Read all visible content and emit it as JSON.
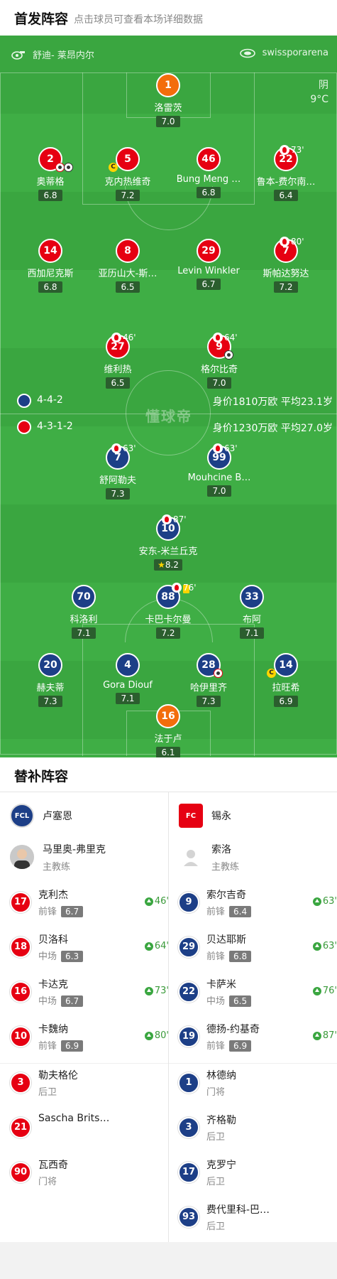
{
  "header": {
    "title": "首发阵容",
    "subtitle": "点击球员可查看本场详细数据"
  },
  "venue": {
    "referee_icon": "whistle-icon",
    "referee": "舒迪- 莱昂内尔",
    "stadium_icon": "stadium-icon",
    "stadium": "swissporarena"
  },
  "weather": {
    "condition": "阴",
    "temperature": "9°C"
  },
  "watermark": "懂球帝",
  "home_team": {
    "formation": "4-4-2",
    "value_text": "身价1810万欧 平均23.1岁",
    "color": "#e60012",
    "players": [
      {
        "num": "1",
        "name": "洛雷茨",
        "rating": "7.0",
        "style": "orange"
      },
      {
        "num": "2",
        "name": "奥蒂格",
        "rating": "6.8",
        "style": "red"
      },
      {
        "num": "5",
        "name": "克内热维奇",
        "rating": "7.2",
        "style": "red"
      },
      {
        "num": "46",
        "name": "Bung Meng …",
        "rating": "6.8",
        "style": "red"
      },
      {
        "num": "22",
        "name": "鲁本-费尔南…",
        "rating": "6.4",
        "style": "red",
        "sub_minute": "73'"
      },
      {
        "num": "14",
        "name": "西加尼克斯",
        "rating": "6.8",
        "style": "red"
      },
      {
        "num": "8",
        "name": "亚历山大-斯…",
        "rating": "6.5",
        "style": "red"
      },
      {
        "num": "29",
        "name": "Levin Winkler",
        "rating": "6.7",
        "style": "red"
      },
      {
        "num": "7",
        "name": "斯帕达努达",
        "rating": "7.2",
        "style": "red",
        "sub_minute": "80'"
      },
      {
        "num": "27",
        "name": "维利热",
        "rating": "6.5",
        "style": "red",
        "sub_minute": "46'"
      },
      {
        "num": "9",
        "name": "格尔比奇",
        "rating": "7.0",
        "style": "red",
        "sub_minute": "64'"
      }
    ]
  },
  "away_team": {
    "formation": "4-3-1-2",
    "value_text": "身价1230万欧 平均27.0岁",
    "color": "#1d3f87",
    "players": [
      {
        "num": "7",
        "name": "舒阿勒夫",
        "rating": "7.3",
        "style": "blue",
        "sub_minute": "63'"
      },
      {
        "num": "99",
        "name": "Mouhcine B…",
        "rating": "7.0",
        "style": "blue",
        "sub_minute": "63'"
      },
      {
        "num": "10",
        "name": "安东-米兰丘克",
        "rating": "8.2",
        "style": "blue",
        "sub_minute": "87'"
      },
      {
        "num": "70",
        "name": "科洛利",
        "rating": "7.1",
        "style": "blue"
      },
      {
        "num": "88",
        "name": "卡巴卡尔曼",
        "rating": "7.2",
        "style": "blue",
        "sub_minute": "76'"
      },
      {
        "num": "33",
        "name": "布阿",
        "rating": "7.1",
        "style": "blue"
      },
      {
        "num": "20",
        "name": "赫夫蒂",
        "rating": "7.3",
        "style": "blue"
      },
      {
        "num": "4",
        "name": "Gora Diouf",
        "rating": "7.1",
        "style": "blue"
      },
      {
        "num": "28",
        "name": "哈伊里齐",
        "rating": "7.3",
        "style": "blue"
      },
      {
        "num": "14",
        "name": "拉旺希",
        "rating": "6.9",
        "style": "blue"
      },
      {
        "num": "16",
        "name": "法于卢",
        "rating": "6.1",
        "style": "orange"
      }
    ]
  },
  "subs": {
    "title": "替补阵容",
    "left": {
      "team_name": "卢塞恩",
      "logo_text": "FCL",
      "coach": {
        "name": "马里奥-弗里克",
        "role": "主教练"
      },
      "players": [
        {
          "num": "17",
          "name": "克利杰",
          "pos": "前锋",
          "rating": "6.7",
          "minute": "46'"
        },
        {
          "num": "18",
          "name": "贝洛科",
          "pos": "中场",
          "rating": "6.3",
          "minute": "64'"
        },
        {
          "num": "16",
          "name": "卡达克",
          "pos": "中场",
          "rating": "6.7",
          "minute": "73'"
        },
        {
          "num": "10",
          "name": "卡魏纳",
          "pos": "前锋",
          "rating": "6.9",
          "minute": "80'"
        },
        {
          "num": "3",
          "name": "勒夫格伦",
          "pos": "后卫"
        },
        {
          "num": "21",
          "name": "Sascha Brits…",
          "pos": ""
        },
        {
          "num": "90",
          "name": "瓦西奇",
          "pos": "门将"
        }
      ]
    },
    "right": {
      "team_name": "锡永",
      "logo_text": "FC",
      "coach": {
        "name": "索洛",
        "role": "主教练"
      },
      "players": [
        {
          "num": "9",
          "name": "索尔吉奇",
          "pos": "前锋",
          "rating": "6.4",
          "minute": "63'"
        },
        {
          "num": "29",
          "name": "贝达耶斯",
          "pos": "前锋",
          "rating": "6.8",
          "minute": "63'"
        },
        {
          "num": "22",
          "name": "卡萨米",
          "pos": "中场",
          "rating": "6.5",
          "minute": "76'"
        },
        {
          "num": "19",
          "name": "德扬-约基奇",
          "pos": "前锋",
          "rating": "6.9",
          "minute": "87'"
        },
        {
          "num": "1",
          "name": "林德纳",
          "pos": "门将"
        },
        {
          "num": "3",
          "name": "齐格勒",
          "pos": "后卫"
        },
        {
          "num": "17",
          "name": "克罗宁",
          "pos": "后卫"
        },
        {
          "num": "93",
          "name": "费代里科-巴…",
          "pos": "后卫"
        }
      ]
    }
  }
}
